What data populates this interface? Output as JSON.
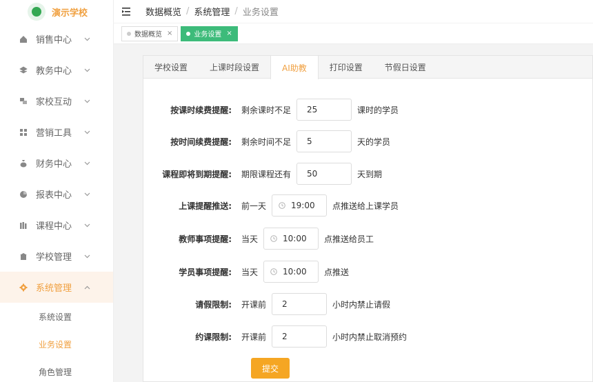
{
  "app": {
    "name": "演示学校"
  },
  "sidebar": {
    "items": [
      {
        "label": "销售中心"
      },
      {
        "label": "教务中心"
      },
      {
        "label": "家校互动"
      },
      {
        "label": "营销工具"
      },
      {
        "label": "财务中心"
      },
      {
        "label": "报表中心"
      },
      {
        "label": "课程中心"
      },
      {
        "label": "学校管理"
      },
      {
        "label": "系统管理"
      }
    ],
    "subitems": [
      {
        "label": "系统设置"
      },
      {
        "label": "业务设置"
      },
      {
        "label": "角色管理"
      }
    ]
  },
  "breadcrumb": {
    "items": [
      "数据概览",
      "系统管理",
      "业务设置"
    ],
    "separator": "/"
  },
  "tags": [
    {
      "label": "数据概览",
      "close": "×"
    },
    {
      "label": "业务设置",
      "close": "×"
    }
  ],
  "tabs": [
    "学校设置",
    "上课时段设置",
    "AI助教",
    "打印设置",
    "节假日设置"
  ],
  "form": {
    "rows": [
      {
        "label": "按课时续费提醒:",
        "prefix": "剩余课时不足",
        "value": "25",
        "suffix": "课时的学员"
      },
      {
        "label": "按时间续费提醒:",
        "prefix": "剩余时间不足",
        "value": "5",
        "suffix": "天的学员"
      },
      {
        "label": "课程即将到期提醒:",
        "prefix": "期限课程还有",
        "value": "50",
        "suffix": "天到期"
      },
      {
        "label": "上课提醒推送:",
        "prefix": "前一天",
        "value": "19:00",
        "suffix": "点推送给上课学员"
      },
      {
        "label": "教师事项提醒:",
        "prefix": "当天",
        "value": "10:00",
        "suffix": "点推送给员工"
      },
      {
        "label": "学员事项提醒:",
        "prefix": "当天",
        "value": "10:00",
        "suffix": "点推送"
      },
      {
        "label": "请假限制:",
        "prefix": "开课前",
        "value": "2",
        "suffix": "小时内禁止请假"
      },
      {
        "label": "约课限制:",
        "prefix": "开课前",
        "value": "2",
        "suffix": "小时内禁止取消预约"
      }
    ],
    "submit_label": "提交"
  },
  "colors": {
    "accent": "#f0a040",
    "tag_active": "#3dbb7a",
    "submit": "#f5a623"
  }
}
